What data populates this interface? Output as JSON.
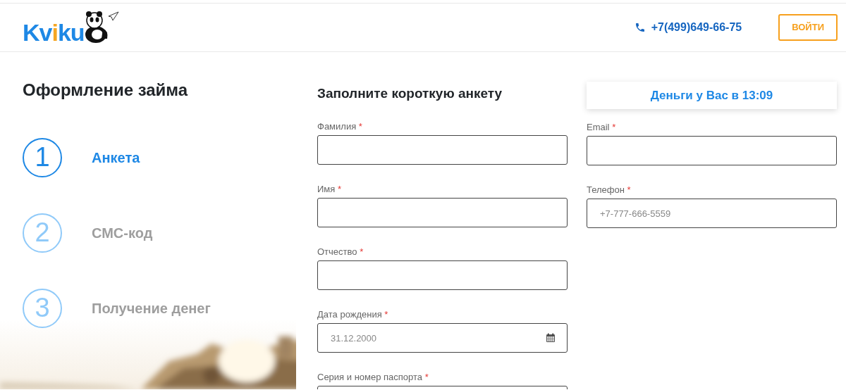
{
  "header": {
    "logo": {
      "parts": [
        {
          "text": "Kv",
          "accent": false
        },
        {
          "text": "i",
          "accent": true
        },
        {
          "text": "ku",
          "accent": false
        }
      ]
    },
    "phone": "+7(499)649-66-75",
    "login_button": "ВОЙТИ"
  },
  "sidebar": {
    "title": "Оформление займа",
    "steps": [
      {
        "number": "1",
        "label": "Анкета",
        "selected": true
      },
      {
        "number": "2",
        "label": "СМС-код",
        "selected": false
      },
      {
        "number": "3",
        "label": "Получение денег",
        "selected": false
      }
    ]
  },
  "form": {
    "title": "Заполните короткую анкету",
    "timer": "Деньги у Вас в 13:09",
    "left_fields": [
      {
        "label": "Фамилия",
        "mark": "*",
        "kind": "text"
      },
      {
        "label": "Имя",
        "mark": "*",
        "kind": "text"
      },
      {
        "label": "Отчество",
        "mark": "*",
        "kind": "text"
      },
      {
        "label": "Дата рождения",
        "mark": "*",
        "kind": "date",
        "placeholder": "31.12.2000"
      },
      {
        "label": "Серия и номер паспорта",
        "mark": "*",
        "kind": "text"
      }
    ],
    "right_fields": [
      {
        "label": "Email",
        "mark": "*",
        "kind": "text"
      },
      {
        "label": "Телефон",
        "mark": "*",
        "kind": "text",
        "placeholder": "+7-777-666-5559"
      }
    ]
  }
}
